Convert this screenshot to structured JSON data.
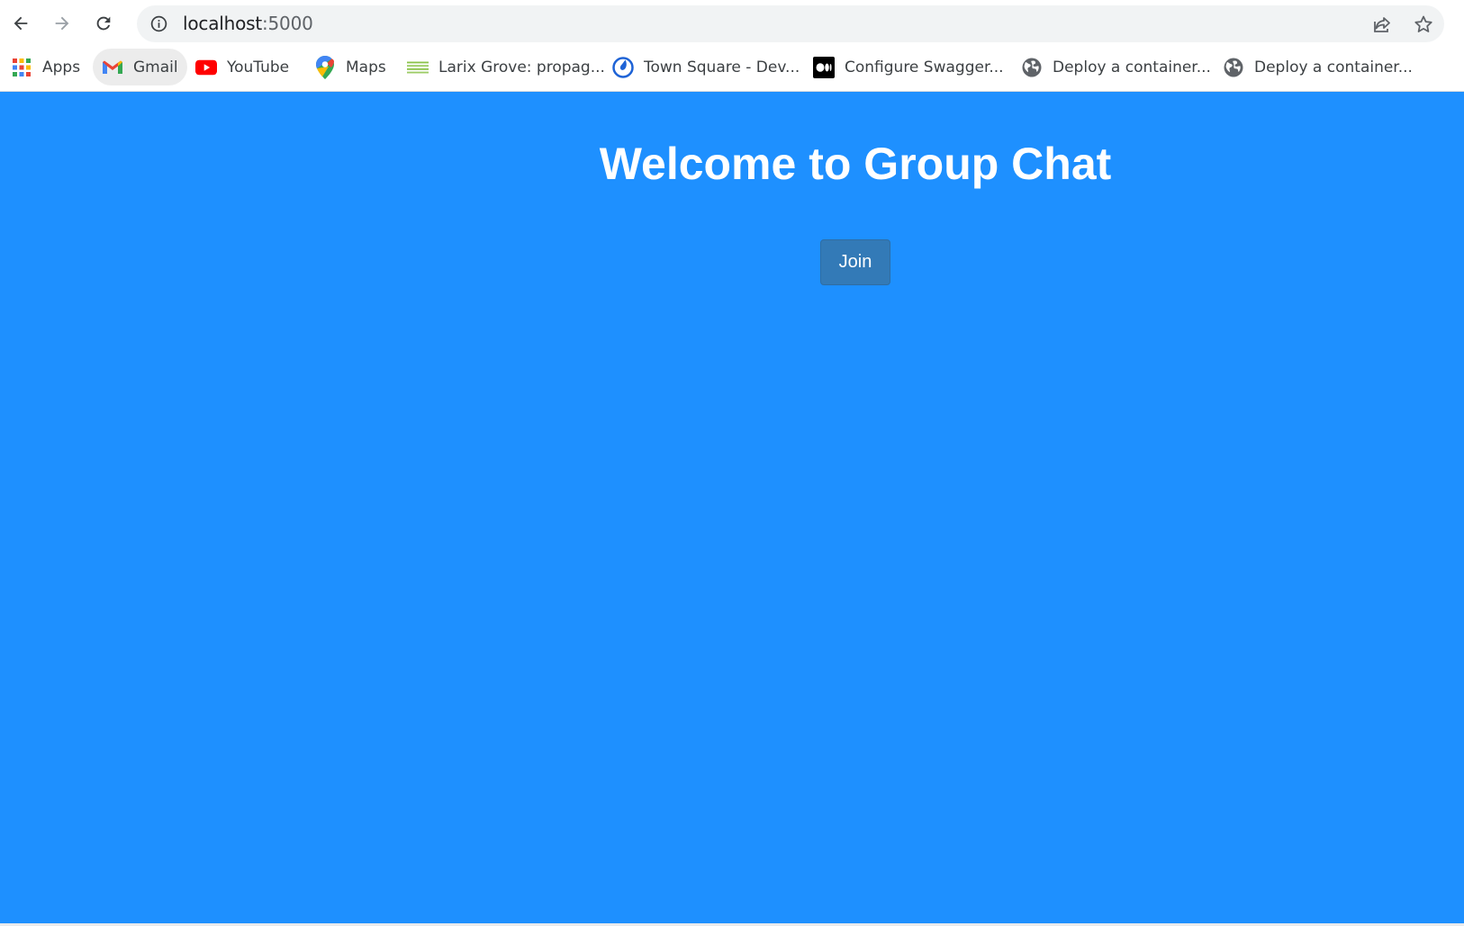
{
  "browser": {
    "url_host": "localhost",
    "url_port": ":5000",
    "nav": {
      "back_icon": "arrow-left-icon",
      "forward_icon": "arrow-right-icon",
      "reload_icon": "reload-icon"
    },
    "omnibox_icons": [
      "info-icon",
      "share-icon",
      "star-icon"
    ]
  },
  "bookmarks": [
    {
      "label": "Apps",
      "icon": "apps-grid-icon"
    },
    {
      "label": "Gmail",
      "icon": "gmail-icon",
      "active": true
    },
    {
      "label": "YouTube",
      "icon": "youtube-icon"
    },
    {
      "label": "Maps",
      "icon": "maps-pin-icon"
    },
    {
      "label": "Larix Grove: propag...",
      "icon": "larix-icon"
    },
    {
      "label": "Town Square - Dev...",
      "icon": "mattermost-icon"
    },
    {
      "label": "Configure Swagger...",
      "icon": "medium-icon"
    },
    {
      "label": "Deploy a container...",
      "icon": "globe-icon"
    },
    {
      "label": "Deploy a container...",
      "icon": "globe-icon"
    }
  ],
  "page": {
    "title": "Welcome to Group Chat",
    "join_label": "Join"
  },
  "colors": {
    "page_background": "#1e90ff",
    "join_button": "#337ab7",
    "title_text": "#ffffff"
  }
}
